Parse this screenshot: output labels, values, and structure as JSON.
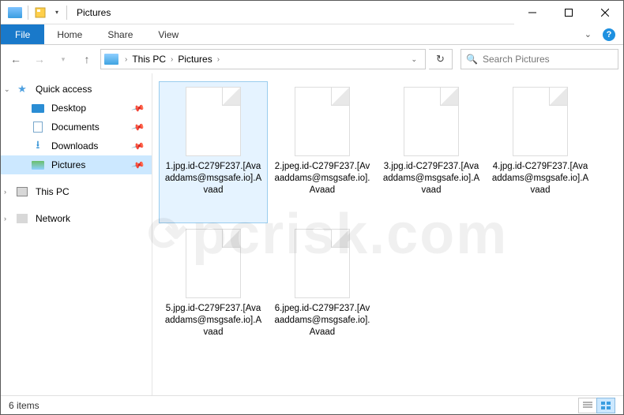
{
  "titlebar": {
    "title": "Pictures"
  },
  "ribbon": {
    "file": "File",
    "tabs": [
      "Home",
      "Share",
      "View"
    ]
  },
  "breadcrumb": {
    "items": [
      "This PC",
      "Pictures"
    ]
  },
  "search": {
    "placeholder": "Search Pictures"
  },
  "sidebar": {
    "quick_access": "Quick access",
    "items": [
      {
        "label": "Desktop",
        "pinned": true
      },
      {
        "label": "Documents",
        "pinned": true
      },
      {
        "label": "Downloads",
        "pinned": true
      },
      {
        "label": "Pictures",
        "pinned": true,
        "selected": true
      }
    ],
    "this_pc": "This PC",
    "network": "Network"
  },
  "files": [
    {
      "name": "1.jpg.id-C279F237.[Avaaddams@msgsafe.io].Avaad",
      "selected": true
    },
    {
      "name": "2.jpeg.id-C279F237.[Avaaddams@msgsafe.io].Avaad"
    },
    {
      "name": "3.jpg.id-C279F237.[Avaaddams@msgsafe.io].Avaad"
    },
    {
      "name": "4.jpg.id-C279F237.[Avaaddams@msgsafe.io].Avaad"
    },
    {
      "name": "5.jpg.id-C279F237.[Avaaddams@msgsafe.io].Avaad"
    },
    {
      "name": "6.jpeg.id-C279F237.[Avaaddams@msgsafe.io].Avaad"
    }
  ],
  "status": {
    "count": "6 items"
  },
  "watermark": "pcrisk.com"
}
